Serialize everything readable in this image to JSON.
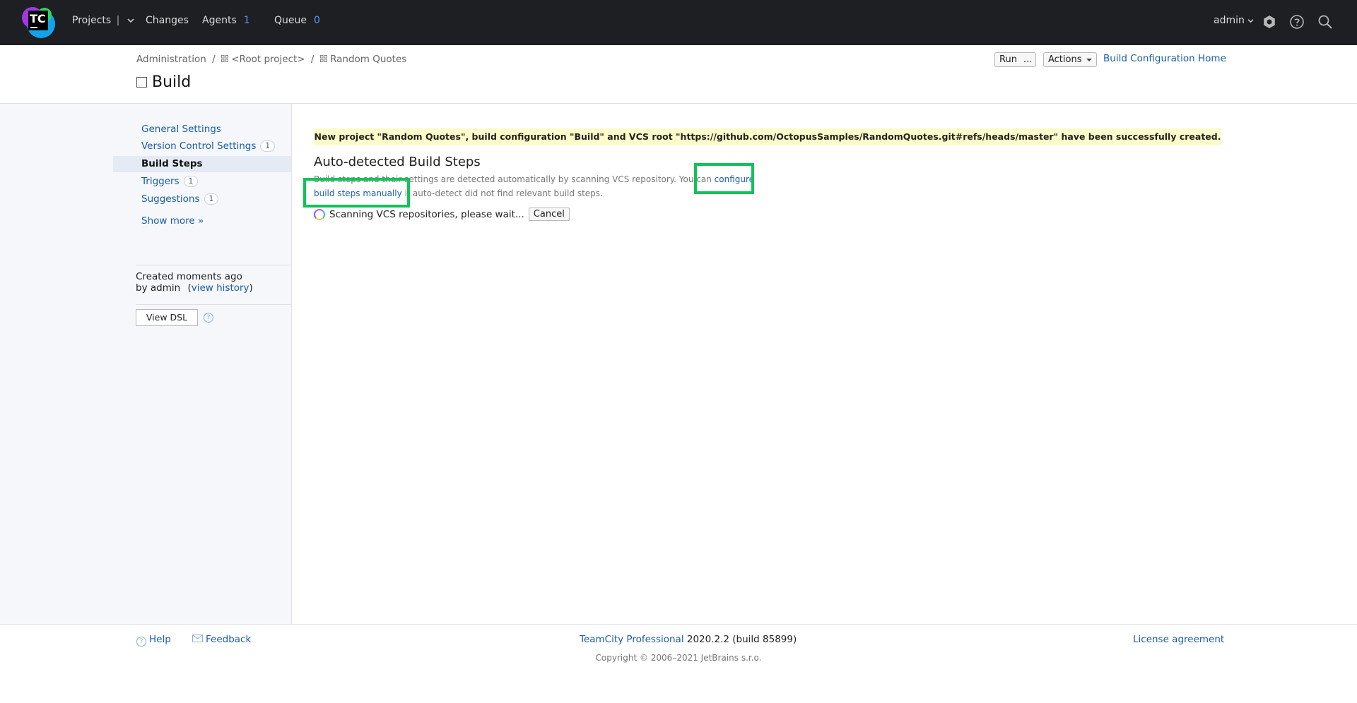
{
  "topbar": {
    "logo_text": "TC",
    "projects_label": "Projects",
    "changes_label": "Changes",
    "agents_label": "Agents",
    "agents_count": "1",
    "queue_label": "Queue",
    "queue_count": "0",
    "user_label": "admin"
  },
  "header": {
    "breadcrumb": {
      "administration": "Administration",
      "sep1": "/",
      "root_project": "<Root project>",
      "sep2": "/",
      "project": "Random Quotes"
    },
    "title": "Build",
    "run_label": "Run",
    "more_label": "...",
    "actions_label": "Actions",
    "home_link": "Build Configuration Home"
  },
  "sidebar": {
    "items": [
      {
        "label": "General Settings",
        "badge": ""
      },
      {
        "label": "Version Control Settings",
        "badge": "1"
      },
      {
        "label": "Build Steps",
        "badge": ""
      },
      {
        "label": "Triggers",
        "badge": "1"
      },
      {
        "label": "Suggestions",
        "badge": "1"
      }
    ],
    "show_more": "Show more »",
    "created_line1": "Created moments ago",
    "created_by": "by admin",
    "view_history": "view history",
    "view_dsl": "View DSL"
  },
  "main": {
    "banner": "New project \"Random Quotes\", build configuration \"Build\" and VCS root \"https://github.com/OctopusSamples/RandomQuotes.git#refs/heads/master\" have been successfully created.",
    "section_title": "Auto-detected Build Steps",
    "desc_prefix": "Build steps and their settings are detected automatically by scanning VCS repository. You can",
    "desc_link_part1": "configure",
    "desc_link_part2": "build steps manually",
    "desc_suffix": "if auto-detect did not find relevant build steps.",
    "scanning_text": "Scanning VCS repositories, please wait...",
    "cancel_label": "Cancel"
  },
  "footer": {
    "help": "Help",
    "feedback": "Feedback",
    "product": "TeamCity Professional",
    "version": "2020.2.2 (build 85899)",
    "license": "License agreement",
    "copyright": "Copyright © 2006–2021 JetBrains s.r.o."
  },
  "colors": {
    "topbar_bg": "#1e1f22",
    "link": "#1a5ea6",
    "banner_bg": "#fdfbc9",
    "highlight": "#12c259",
    "sidebar_bg": "#f5f7fa"
  }
}
